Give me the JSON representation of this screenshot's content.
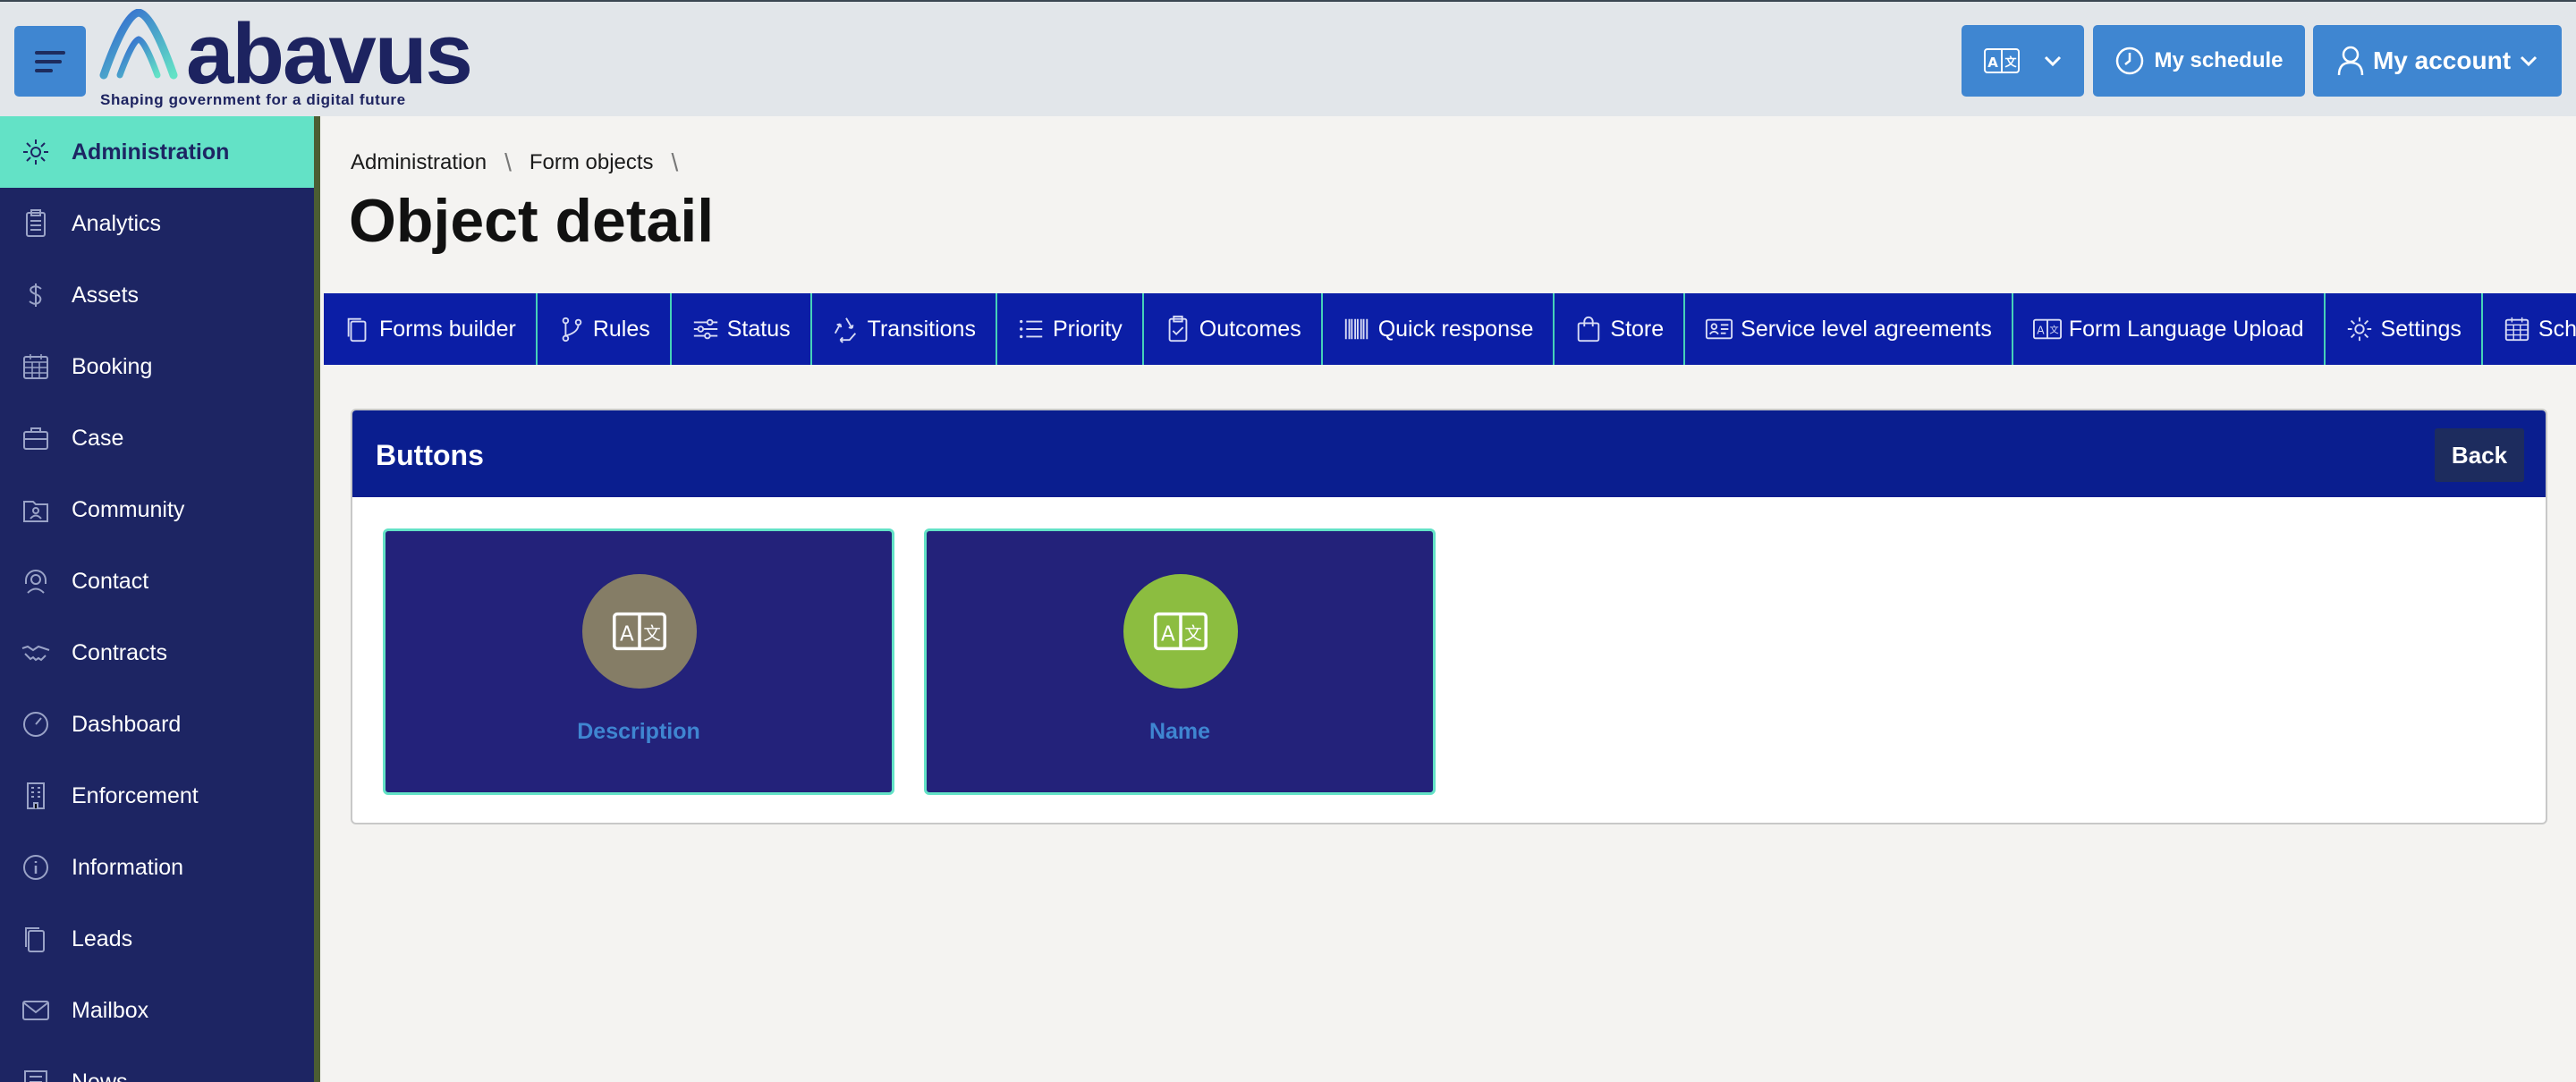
{
  "header": {
    "logo_text": "abavus",
    "logo_tagline": "Shaping government for a digital future",
    "language_button_icon": "translate-icon",
    "schedule_label": "My schedule",
    "account_label": "My account"
  },
  "sidebar": {
    "items": [
      {
        "label": "Administration",
        "icon": "gear-icon",
        "active": true
      },
      {
        "label": "Analytics",
        "icon": "clipboard-icon"
      },
      {
        "label": "Assets",
        "icon": "dollar-icon"
      },
      {
        "label": "Booking",
        "icon": "calendar-icon"
      },
      {
        "label": "Case",
        "icon": "briefcase-icon"
      },
      {
        "label": "Community",
        "icon": "community-folder-icon"
      },
      {
        "label": "Contact",
        "icon": "headset-icon"
      },
      {
        "label": "Contracts",
        "icon": "handshake-icon"
      },
      {
        "label": "Dashboard",
        "icon": "speedometer-icon"
      },
      {
        "label": "Enforcement",
        "icon": "building-icon"
      },
      {
        "label": "Information",
        "icon": "info-icon"
      },
      {
        "label": "Leads",
        "icon": "copy-icon"
      },
      {
        "label": "Mailbox",
        "icon": "envelope-icon"
      },
      {
        "label": "News",
        "icon": "newspaper-icon"
      }
    ]
  },
  "breadcrumb": [
    "Administration",
    "Form objects"
  ],
  "page_title": "Object detail",
  "tabs": [
    {
      "label": "Forms builder",
      "icon": "copy-icon"
    },
    {
      "label": "Rules",
      "icon": "branch-icon"
    },
    {
      "label": "Status",
      "icon": "sliders-icon"
    },
    {
      "label": "Transitions",
      "icon": "recycle-icon"
    },
    {
      "label": "Priority",
      "icon": "list-icon"
    },
    {
      "label": "Outcomes",
      "icon": "clipboard-check-icon"
    },
    {
      "label": "Quick response",
      "icon": "barcode-icon"
    },
    {
      "label": "Store",
      "icon": "shopping-bag-icon"
    },
    {
      "label": "Service level agreements",
      "icon": "id-card-icon"
    },
    {
      "label": "Form Language Upload",
      "icon": "translate-icon"
    },
    {
      "label": "Settings",
      "icon": "gear-icon"
    },
    {
      "label": "Schedule",
      "icon": "calendar-icon"
    }
  ],
  "panel": {
    "title": "Buttons",
    "back_label": "Back",
    "tiles": [
      {
        "label": "Description",
        "icon": "translate-icon",
        "color": "#857d66"
      },
      {
        "label": "Name",
        "icon": "translate-icon",
        "color": "#8cbd40"
      }
    ]
  },
  "colors": {
    "primary": "#3f86d1",
    "navy": "#1d2563",
    "tab_bar": "#0b1ea6",
    "accent": "#63e2c6"
  }
}
